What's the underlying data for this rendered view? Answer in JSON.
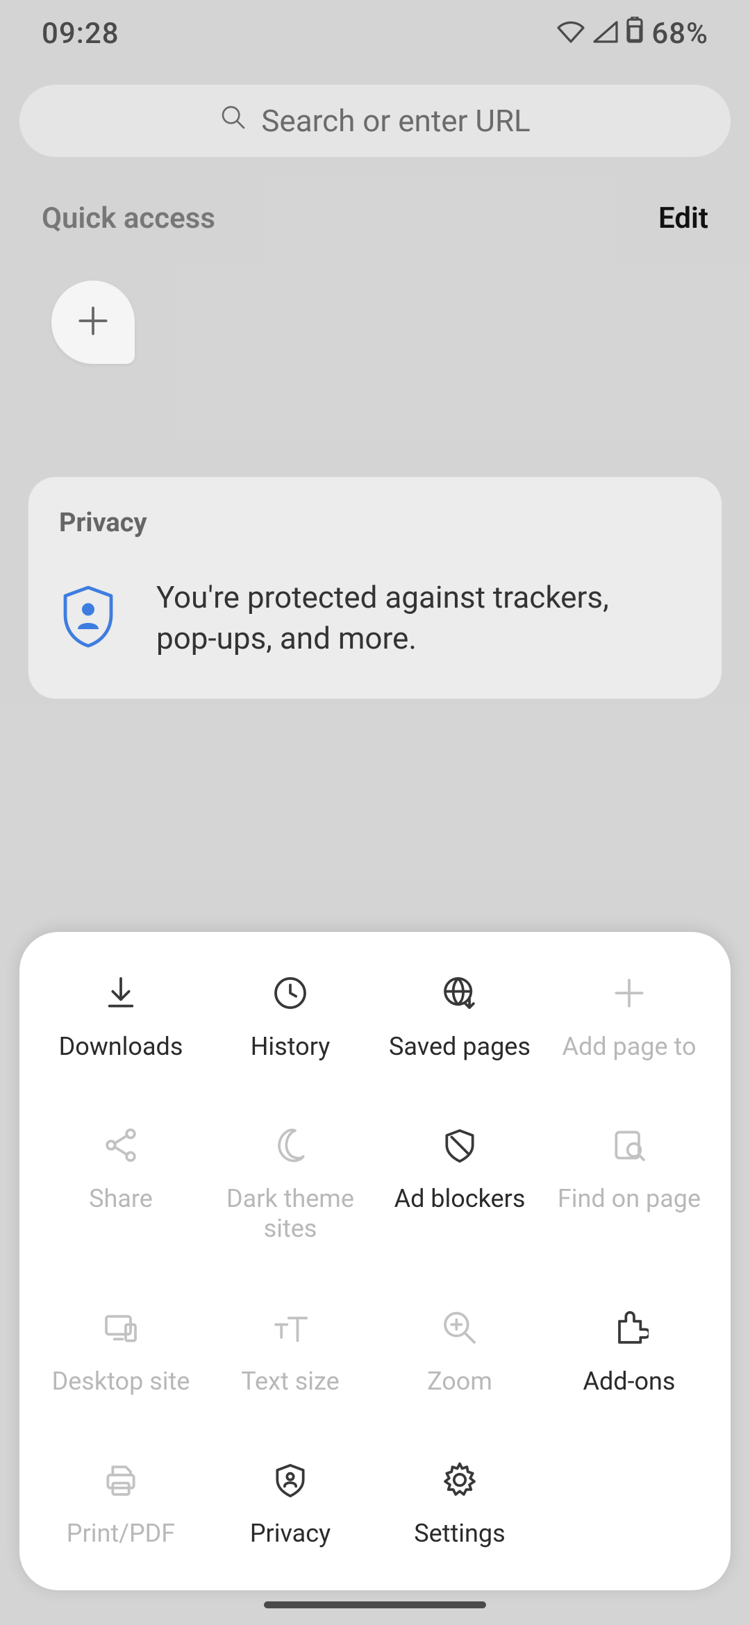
{
  "status": {
    "time": "09:28",
    "battery_pct": "68%"
  },
  "search": {
    "placeholder": "Search or enter URL"
  },
  "quick_access": {
    "label": "Quick access",
    "edit": "Edit"
  },
  "privacy_card": {
    "title": "Privacy",
    "text": "You're protected against trackers, pop‑ups, and more."
  },
  "menu": {
    "items": [
      {
        "label": "Downloads"
      },
      {
        "label": "History"
      },
      {
        "label": "Saved pages"
      },
      {
        "label": "Add page to"
      },
      {
        "label": "Share"
      },
      {
        "label": "Dark theme sites"
      },
      {
        "label": "Ad blockers"
      },
      {
        "label": "Find on page"
      },
      {
        "label": "Desktop site"
      },
      {
        "label": "Text size"
      },
      {
        "label": "Zoom"
      },
      {
        "label": "Add-ons"
      },
      {
        "label": "Print/PDF"
      },
      {
        "label": "Privacy"
      },
      {
        "label": "Settings"
      }
    ]
  }
}
